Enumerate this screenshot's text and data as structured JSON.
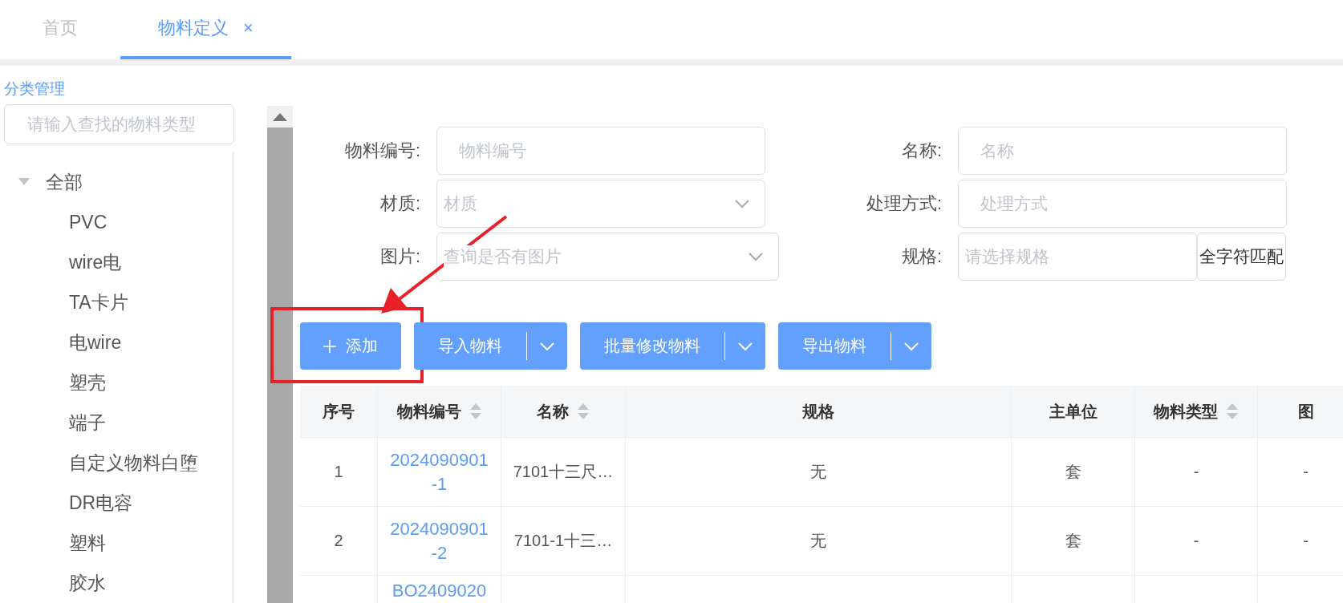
{
  "tabs": [
    {
      "label": "首页",
      "selected": false,
      "closable": false
    },
    {
      "label": "物料定义",
      "selected": true,
      "closable": true,
      "close": "×"
    }
  ],
  "sidebar": {
    "title": "分类管理",
    "search": {
      "placeholder": "请输入查找的物料类型"
    },
    "tree": [
      {
        "label": "全部",
        "expanded": true,
        "children": [
          {
            "label": "PVC"
          },
          {
            "label": "wire电"
          },
          {
            "label": "TA卡片"
          },
          {
            "label": "电wire"
          },
          {
            "label": "塑壳"
          },
          {
            "label": "端子"
          },
          {
            "label": "自定义物料白堕"
          },
          {
            "label": "DR电容"
          },
          {
            "label": "塑料"
          },
          {
            "label": "胶水"
          }
        ]
      }
    ]
  },
  "filters": [
    {
      "label": "物料编号:",
      "kind": "input",
      "placeholder": "物料编号"
    },
    {
      "label": "名称:",
      "kind": "input",
      "placeholder": "名称"
    },
    {
      "label": "材质:",
      "kind": "select",
      "placeholder": "材质"
    },
    {
      "label": "处理方式:",
      "kind": "input",
      "placeholder": "处理方式"
    },
    {
      "label": "图片:",
      "kind": "select",
      "placeholder": "查询是否有图片"
    },
    {
      "label": "规格:",
      "kind": "match",
      "placeholder": "请选择规格",
      "addon": "全字符匹配"
    }
  ],
  "actions": [
    {
      "label": "添加",
      "kind": "add",
      "highlighted": true
    },
    {
      "label": "导入物料",
      "kind": "split",
      "highlighted": false
    },
    {
      "label": "批量修改物料",
      "kind": "split",
      "highlighted": false
    },
    {
      "label": "导出物料",
      "kind": "split",
      "highlighted": false
    }
  ],
  "table": {
    "columns": [
      {
        "label": "序号",
        "sortable": false
      },
      {
        "label": "物料编号",
        "sortable": true
      },
      {
        "label": "名称",
        "sortable": true
      },
      {
        "label": "规格",
        "sortable": false
      },
      {
        "label": "主单位",
        "sortable": false
      },
      {
        "label": "物料类型",
        "sortable": true
      },
      {
        "label": "图",
        "sortable": false
      }
    ],
    "rows": [
      [
        "1",
        "2024090901-1",
        "7101十三尺…",
        "无",
        "套",
        "-",
        "-"
      ],
      [
        "2",
        "2024090901-2",
        "7101-1十三…",
        "无",
        "套",
        "-",
        "-"
      ],
      [
        "",
        "BO2409020",
        "",
        "",
        "",
        "",
        ""
      ]
    ]
  }
}
